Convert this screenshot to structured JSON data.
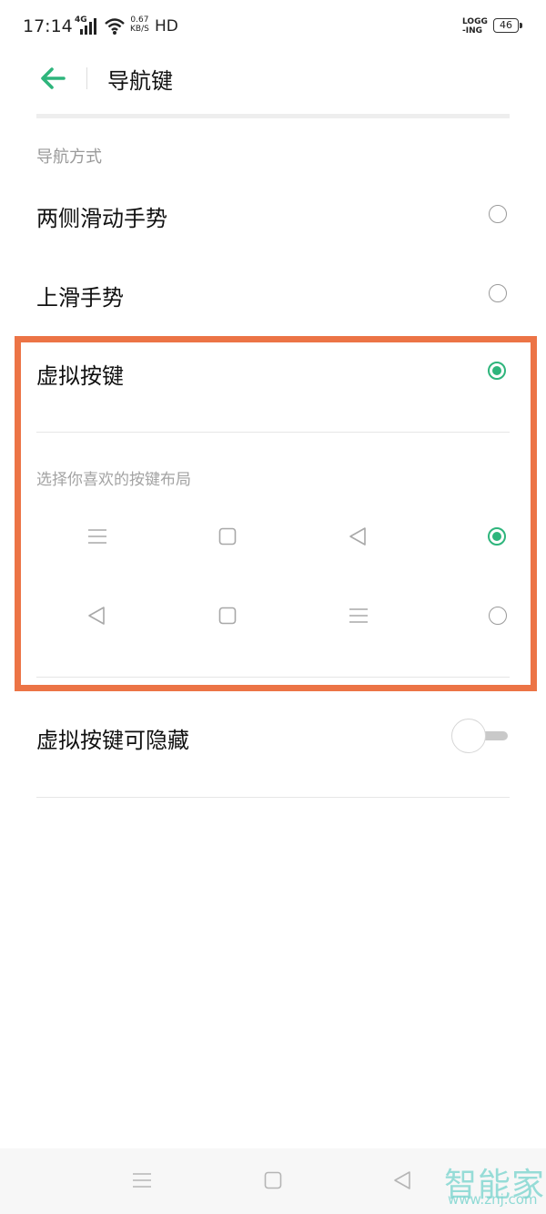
{
  "status_bar": {
    "time": "17:14",
    "network": "4G",
    "speed_value": "0.67",
    "speed_unit": "KB/S",
    "hd": "HD",
    "logging_top": "LOGG",
    "logging_bottom": "-ING",
    "battery": "46"
  },
  "header": {
    "title": "导航键"
  },
  "nav_section": {
    "title": "导航方式",
    "options": [
      {
        "label": "两侧滑动手势",
        "selected": false
      },
      {
        "label": "上滑手势",
        "selected": false
      },
      {
        "label": "虚拟按键",
        "selected": true
      }
    ]
  },
  "layout_section": {
    "title": "选择你喜欢的按键布局",
    "layouts": [
      {
        "icons": [
          "menu-icon",
          "square-icon",
          "back-triangle-icon"
        ],
        "selected": true
      },
      {
        "icons": [
          "back-triangle-icon",
          "square-icon",
          "menu-icon"
        ],
        "selected": false
      }
    ]
  },
  "hideable": {
    "label": "虚拟按键可隐藏",
    "enabled": false
  },
  "nav_bar": {
    "icons": [
      "menu-icon",
      "square-icon",
      "back-triangle-icon"
    ]
  },
  "watermark": {
    "brand": "智能家",
    "url": "www.znj.com"
  },
  "colors": {
    "accent": "#2eb57c",
    "highlight": "#ec7446",
    "muted_text": "#9a9a9a"
  }
}
